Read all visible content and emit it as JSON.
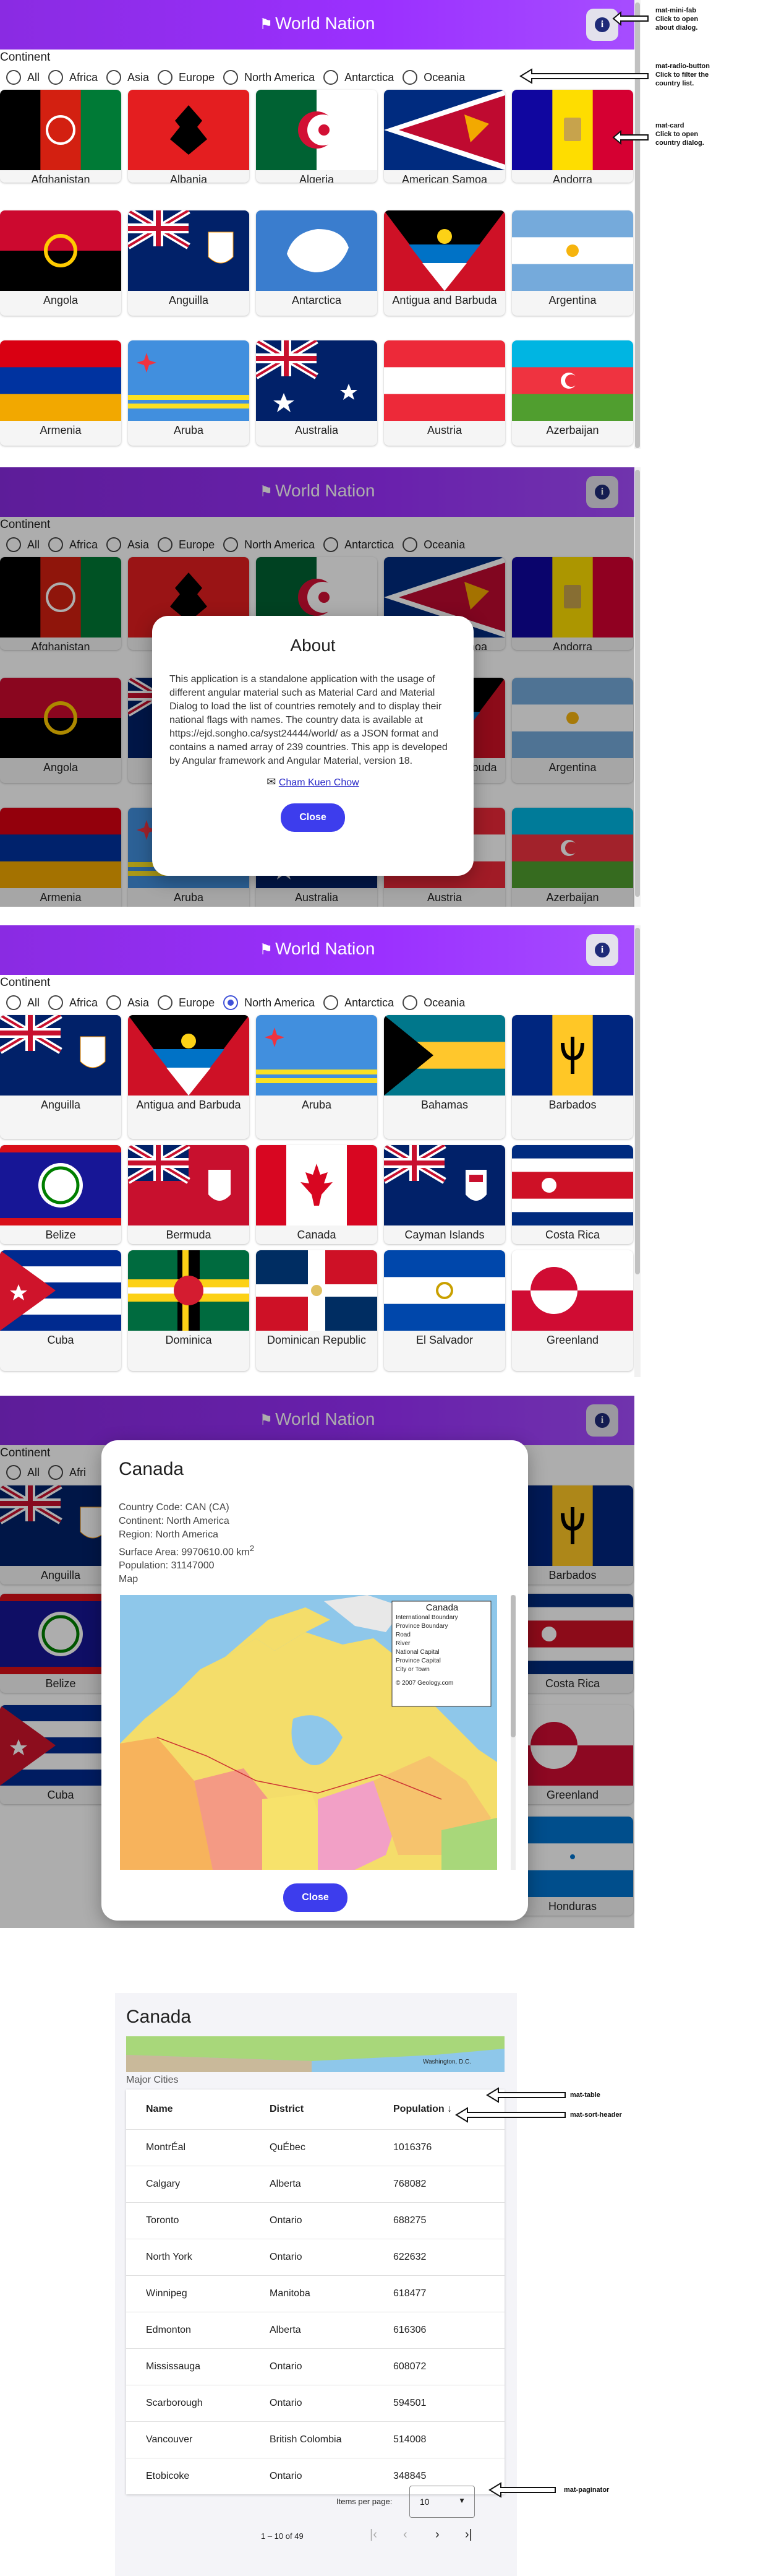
{
  "app": {
    "title": "World Nation",
    "continent_label": "Continent",
    "continents": [
      "All",
      "Africa",
      "Asia",
      "Europe",
      "North America",
      "Antarctica",
      "Oceania"
    ],
    "accent_color": "#8a2be2",
    "button_color": "#3d3ded"
  },
  "icons": {
    "title_flag": "flag-icon",
    "about_fab": "info-icon",
    "author_email": "email-icon"
  },
  "annotations": {
    "fab": [
      "mat-mini-fab",
      "Click to open",
      "about dialog."
    ],
    "radio": [
      "mat-radio-button",
      "Click to filter the",
      "country list."
    ],
    "card": [
      "mat-card",
      "Click to open",
      "country dialog."
    ],
    "table": "mat-table",
    "sort_header": "mat-sort-header",
    "paginator": "mat-paginator"
  },
  "panel1": {
    "selected_continent": "",
    "countries": [
      "Afghanistan",
      "Albania",
      "Algeria",
      "American Samoa",
      "Andorra",
      "Angola",
      "Anguilla",
      "Antarctica",
      "Antigua and Barbuda",
      "Argentina",
      "Armenia",
      "Aruba",
      "Australia",
      "Austria",
      "Azerbaijan"
    ]
  },
  "panel2": {
    "visible_countries": [
      "Afghanistan",
      "Andorra",
      "Angola",
      "Argentina",
      "Armenia",
      "Aruba",
      "Austria",
      "Azerbaijan"
    ],
    "visible_partial": "oa",
    "about": {
      "title": "About",
      "text": "This application is a standalone application with the usage of different angular material such as Material Card and Material Dialog to load the list of countries remotely and to display their national flags with names. The country data is available at https://ejd.songho.ca/syst24444/world/ as a JSON format and contains a named array of 239 countries. This app is developed by Angular framework and Angular Material, version 18.",
      "author": "Cham Kuen Chow",
      "close": "Close"
    }
  },
  "panel3": {
    "selected_continent": "North America",
    "countries": [
      "Anguilla",
      "Antigua and Barbuda",
      "Aruba",
      "Bahamas",
      "Barbados",
      "Belize",
      "Bermuda",
      "Canada",
      "Cayman Islands",
      "Costa Rica",
      "Cuba",
      "Dominica",
      "Dominican Republic",
      "El Salvador",
      "Greenland"
    ]
  },
  "panel4": {
    "left_column": [
      "Anguilla",
      "Belize",
      "Cuba"
    ],
    "right_column": [
      "Barbados",
      "Costa Rica",
      "Greenland",
      "Honduras"
    ],
    "partial_all": "All",
    "partial_africa": "Afri",
    "dialog": {
      "title": "Canada",
      "country_code": "Country Code: CAN (CA)",
      "continent": "Continent: North America",
      "region": "Region: North America",
      "surface_area": "Surface Area: 9970610.00 km",
      "surface_unit_sup": "2",
      "population": "Population: 31147000",
      "map_label": "Map",
      "map_legend_title": "Canada",
      "map_legend_items": [
        "International Boundary",
        "Province Boundary",
        "Road",
        "River",
        "National Capital",
        "Province Capital",
        "City or Town"
      ],
      "map_credit": "© 2007 Geology.com",
      "close": "Close"
    }
  },
  "panel5": {
    "title": "Canada",
    "map_place": "Washington, D.C.",
    "section": "Major Cities",
    "headers": [
      "Name",
      "District",
      "Population"
    ],
    "sort_indicator": "↓",
    "rows": [
      [
        "MontrÉal",
        "QuÉbec",
        "1016376"
      ],
      [
        "Calgary",
        "Alberta",
        "768082"
      ],
      [
        "Toronto",
        "Ontario",
        "688275"
      ],
      [
        "North York",
        "Ontario",
        "622632"
      ],
      [
        "Winnipeg",
        "Manitoba",
        "618477"
      ],
      [
        "Edmonton",
        "Alberta",
        "616306"
      ],
      [
        "Mississauga",
        "Ontario",
        "608072"
      ],
      [
        "Scarborough",
        "Ontario",
        "594501"
      ],
      [
        "Vancouver",
        "British Colombia",
        "514008"
      ],
      [
        "Etobicoke",
        "Ontario",
        "348845"
      ]
    ],
    "items_per_page_label": "Items per page:",
    "items_per_page": "10",
    "range": "1 – 10 of 49"
  }
}
